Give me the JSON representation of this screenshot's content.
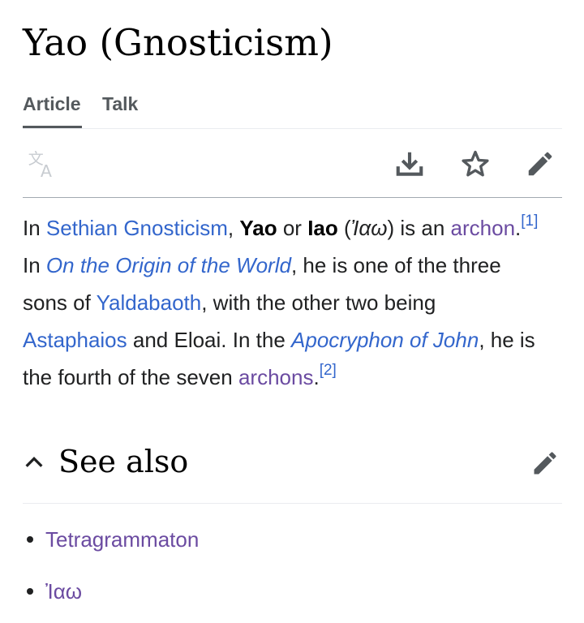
{
  "page": {
    "title": "Yao (Gnosticism)"
  },
  "tabs": [
    {
      "label": "Article",
      "active": true
    },
    {
      "label": "Talk",
      "active": false
    }
  ],
  "toolbar": {
    "icons": [
      "translate-icon",
      "download-icon",
      "star-icon",
      "edit-pencil-icon"
    ]
  },
  "article": {
    "s1": "In ",
    "link_sethian": "Sethian Gnosticism",
    "s2": ", ",
    "yao": "Yao",
    "s3": " or ",
    "iao": "Iao",
    "s4": " (",
    "greek": "Ἰαω",
    "s5": ") is an ",
    "link_archon": "archon",
    "s6": ".",
    "ref1": "[1]",
    "s7": " In ",
    "link_origin": "On the Origin of the World",
    "s8": ", he is one of the three sons of ",
    "link_yaldabaoth": "Yaldabaoth",
    "s9": ", with the other two being ",
    "link_astaphaios": "Astaphaios",
    "s10": " and Eloai. In the ",
    "link_apocryphon": "Apocryphon of John",
    "s11": ", he is the fourth of the seven ",
    "link_archons": "archons",
    "s12": ".",
    "ref2": "[2]"
  },
  "see_also": {
    "heading": "See also",
    "items": [
      "Tetragrammaton",
      "Ἰαω"
    ]
  },
  "colors": {
    "link": "#3366cc",
    "visited_link": "#6b4ba1",
    "text": "#202122",
    "icon": "#54595d",
    "disabled_icon": "#c8ccd1"
  }
}
